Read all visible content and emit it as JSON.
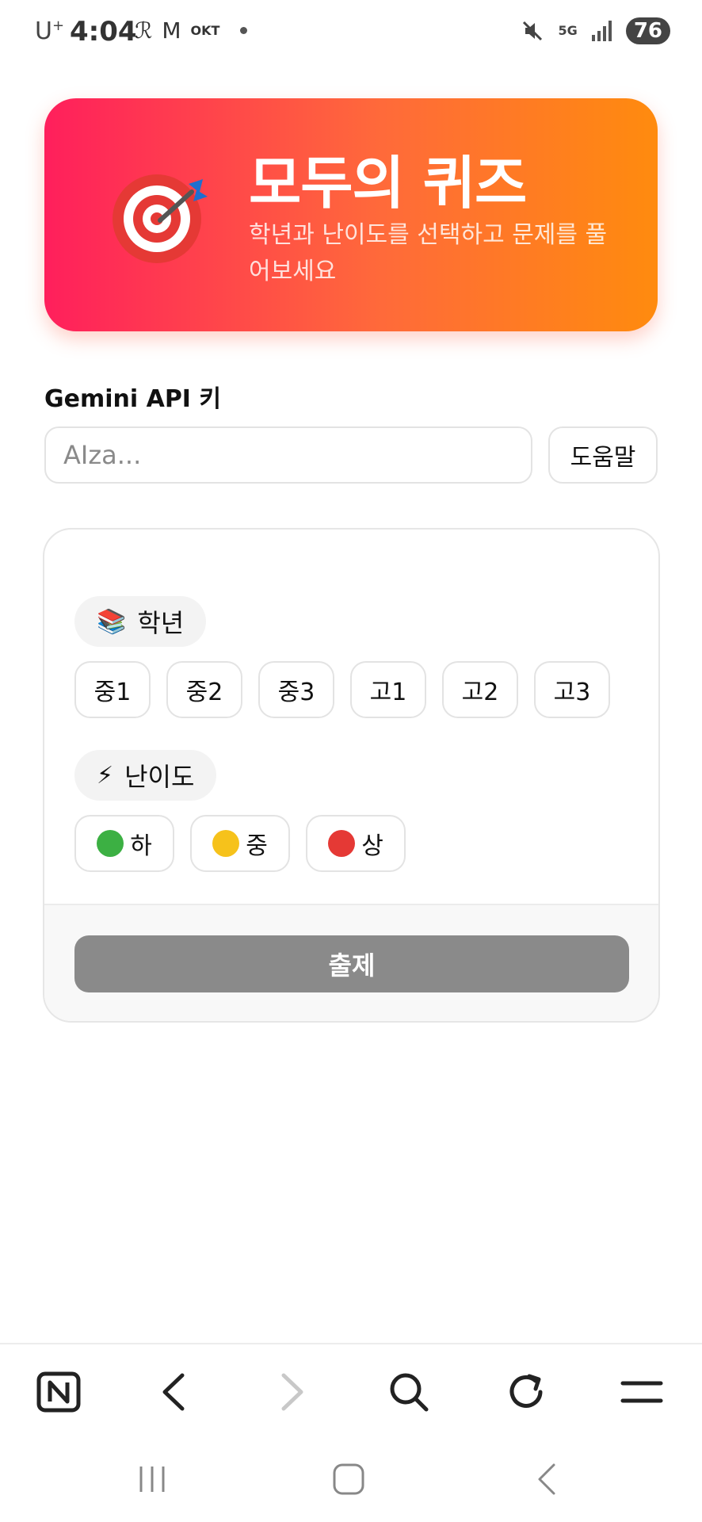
{
  "status_bar": {
    "carrier": "U+",
    "time": "4:04",
    "small_label": "OKT",
    "network": "5G",
    "battery": "76"
  },
  "hero": {
    "title": "모두의 퀴즈",
    "subtitle": "학년과 난이도를 선택하고 문제를 풀어보세요",
    "icon": "target-dart-icon"
  },
  "api": {
    "label": "Gemini API 키",
    "placeholder": "AIza...",
    "value": "",
    "help_label": "도움말"
  },
  "grade": {
    "label": "학년",
    "emoji": "📚",
    "options": [
      "중1",
      "중2",
      "중3",
      "고1",
      "고2",
      "고3"
    ]
  },
  "difficulty": {
    "label": "난이도",
    "emoji": "⚡",
    "options": [
      {
        "label": "하",
        "color": "#3cb043"
      },
      {
        "label": "중",
        "color": "#f6c21b"
      },
      {
        "label": "상",
        "color": "#e53935"
      }
    ]
  },
  "submit_label": "출제",
  "browser_toolbar": [
    "naver-home-icon",
    "back-icon",
    "forward-icon",
    "search-icon",
    "refresh-icon",
    "menu-icon"
  ],
  "system_nav": [
    "recents-icon",
    "home-icon",
    "back-icon"
  ]
}
